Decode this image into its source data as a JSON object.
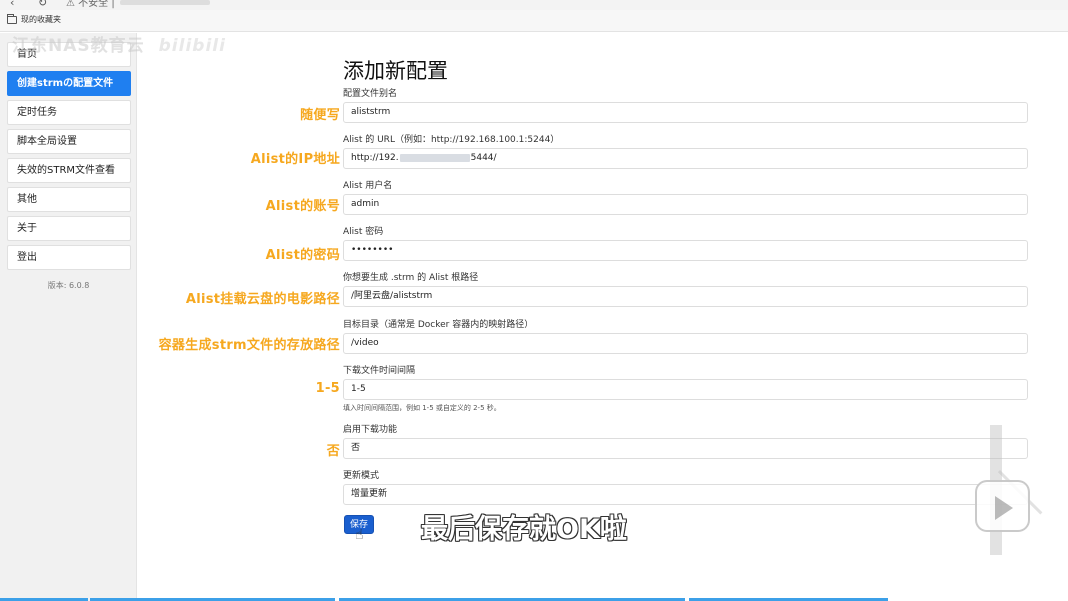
{
  "browser": {
    "address_text": "不安全 |",
    "bookmark_label": "现的收藏夹"
  },
  "watermark": {
    "left_text": "江东NAS教育云",
    "bili_text": "bilibili"
  },
  "sidebar": {
    "items": [
      {
        "label": "首页",
        "active": false
      },
      {
        "label": "创建strmの配置文件",
        "active": true
      },
      {
        "label": "定时任务",
        "active": false
      },
      {
        "label": "脚本全局设置",
        "active": false
      },
      {
        "label": "失效的STRM文件查看",
        "active": false
      },
      {
        "label": "其他",
        "active": false
      },
      {
        "label": "关于",
        "active": false
      },
      {
        "label": "登出",
        "active": false
      }
    ],
    "version": "版本: 6.0.8"
  },
  "form": {
    "title": "添加新配置",
    "fields": [
      {
        "label": "配置文件别名",
        "value": "aliststrm",
        "annotation": "随便写"
      },
      {
        "label": "Alist 的 URL（例如：http://192.168.100.1:5244）",
        "value_prefix": "http://192.",
        "value_suffix": "5444/",
        "annotation": "Alist的IP地址"
      },
      {
        "label": "Alist 用户名",
        "value": "admin",
        "annotation": "Alist的账号"
      },
      {
        "label": "Alist 密码",
        "value": "••••••••",
        "annotation": "Alist的密码"
      },
      {
        "label": "你想要生成 .strm 的 Alist 根路径",
        "value": "/阿里云盘/aliststrm",
        "annotation": "Alist挂载云盘的电影路径"
      },
      {
        "label": "目标目录（通常是 Docker 容器内的映射路径）",
        "value": "/video",
        "annotation": "容器生成strm文件的存放路径"
      },
      {
        "label": "下载文件时间间隔",
        "value": "1-5",
        "annotation": "1-5"
      },
      {
        "label": "启用下载功能",
        "value": "否",
        "annotation": "否"
      },
      {
        "label": "更新模式",
        "value": "增量更新",
        "annotation": ""
      }
    ],
    "interval_help": "填入时间间隔范围，例如 1-5 或自定义的 2-5 秒。",
    "save_label": "保存"
  },
  "video_subtitle": "最后保存就OK啦",
  "colors": {
    "accent_blue": "#1f7ff0",
    "save_blue": "#1a5fcf",
    "annotation_orange": "#f6a81f"
  }
}
